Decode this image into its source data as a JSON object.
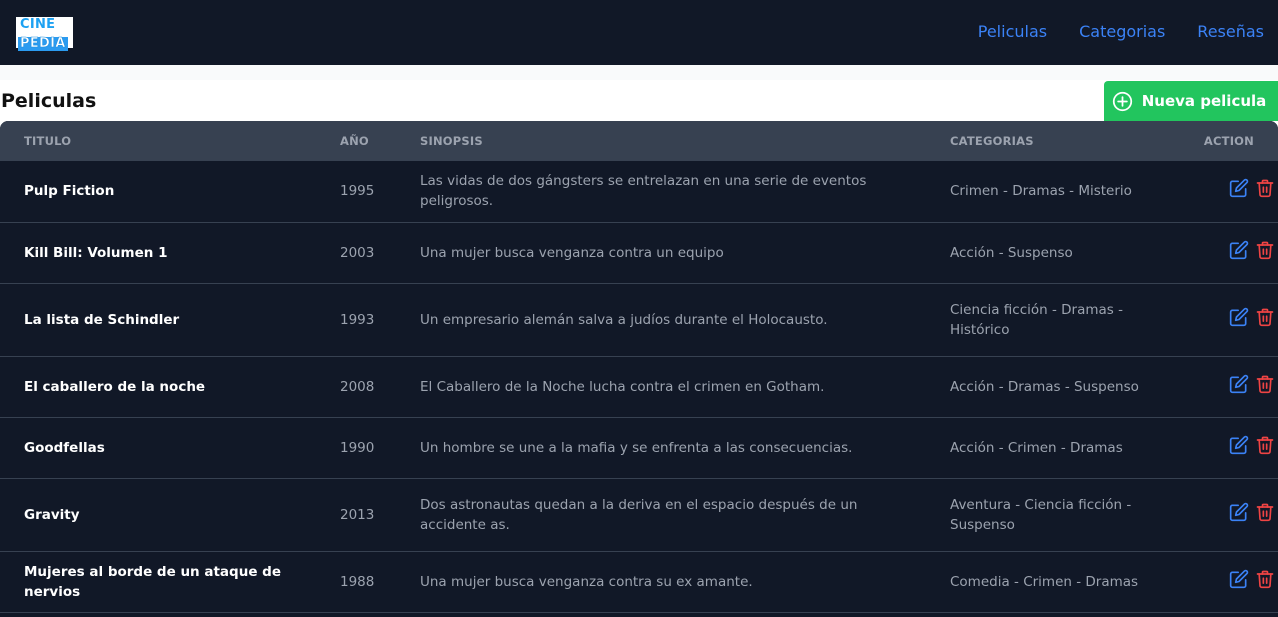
{
  "navbar": {
    "logo_line1": "CINE",
    "logo_line2": "PEDIA",
    "links": [
      "Peliculas",
      "Categorias",
      "Reseñas"
    ]
  },
  "page": {
    "title": "Peliculas",
    "new_button_label": "Nueva pelicula"
  },
  "table": {
    "headers": [
      "TITULO",
      "AÑO",
      "SINOPSIS",
      "CATEGORIAS",
      "ACTION"
    ],
    "rows": [
      {
        "title": "Pulp Fiction",
        "year": "1995",
        "synopsis": "Las vidas de dos gángsters se entrelazan en una serie de eventos peligrosos.",
        "categories": "Crimen - Dramas - Misterio"
      },
      {
        "title": "Kill Bill: Volumen 1",
        "year": "2003",
        "synopsis": "Una mujer busca venganza contra un equipo",
        "categories": "Acción - Suspenso"
      },
      {
        "title": "La lista de Schindler",
        "year": "1993",
        "synopsis": "Un empresario alemán salva a judíos durante el Holocausto.",
        "categories": "Ciencia ficción - Dramas - Histórico"
      },
      {
        "title": "El caballero de la noche",
        "year": "2008",
        "synopsis": "El Caballero de la Noche lucha contra el crimen en Gotham.",
        "categories": "Acción - Dramas - Suspenso"
      },
      {
        "title": "Goodfellas",
        "year": "1990",
        "synopsis": "Un hombre se une a la mafia y se enfrenta a las consecuencias.",
        "categories": "Acción - Crimen - Dramas"
      },
      {
        "title": "Gravity",
        "year": "2013",
        "synopsis": "Dos astronautas quedan a la deriva en el espacio después de un accidente as.",
        "categories": "Aventura - Ciencia ficción - Suspenso"
      },
      {
        "title": "Mujeres al borde de un ataque de nervios",
        "year": "1988",
        "synopsis": "Una mujer busca venganza contra su ex amante.",
        "categories": "Comedia - Crimen - Dramas"
      }
    ]
  },
  "icons": {
    "edit": "pencil-square-icon",
    "delete": "trash-icon",
    "add": "plus-circle-icon"
  },
  "colors": {
    "nav_bg": "#111827",
    "link": "#3b82f6",
    "primary_button": "#22c55e",
    "table_header_bg": "#374151",
    "edit_icon": "#3b82f6",
    "delete_icon": "#ef4444"
  }
}
